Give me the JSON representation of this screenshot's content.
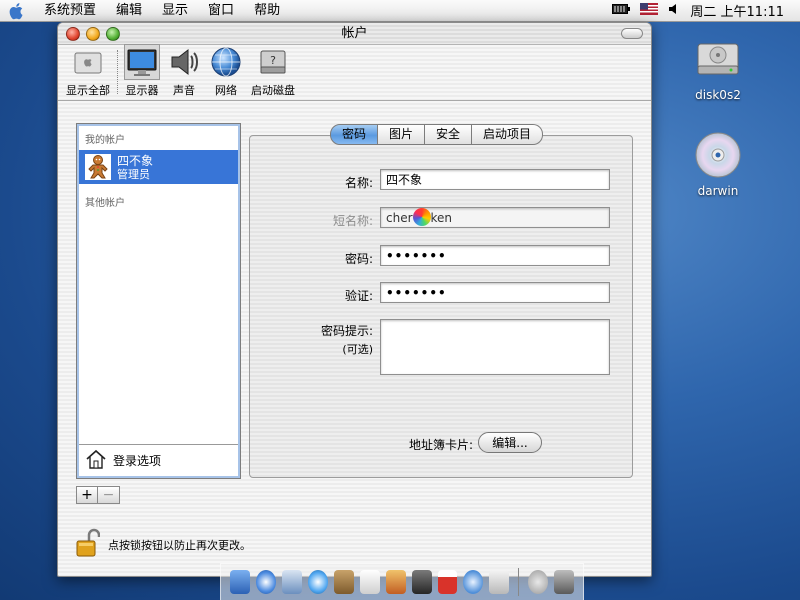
{
  "menubar": {
    "items": [
      {
        "label": "系统预置"
      },
      {
        "label": "编辑"
      },
      {
        "label": "显示"
      },
      {
        "label": "窗口"
      },
      {
        "label": "帮助"
      }
    ],
    "clock": "周二 上午11:11"
  },
  "desktop": {
    "icons": [
      {
        "label": "disk0s2",
        "icon": "hard-disk-icon"
      },
      {
        "label": "darwin",
        "icon": "cd-disc-icon"
      }
    ]
  },
  "window": {
    "title": "帐户",
    "toolbar": [
      {
        "label": "显示全部",
        "icon": "show-all-icon"
      },
      {
        "label": "显示器",
        "icon": "display-icon",
        "selected": true
      },
      {
        "label": "声音",
        "icon": "speaker-icon"
      },
      {
        "label": "网络",
        "icon": "network-globe-icon"
      },
      {
        "label": "启动磁盘",
        "icon": "startup-disk-icon"
      }
    ]
  },
  "accounts": {
    "my_header": "我的帐户",
    "current_user": {
      "name": "四不象",
      "role": "管理员"
    },
    "other_header": "其他帐户",
    "login_options": "登录选项",
    "add_label": "+",
    "remove_label": "−"
  },
  "tabs": [
    {
      "label": "密码",
      "active": true
    },
    {
      "label": "图片"
    },
    {
      "label": "安全"
    },
    {
      "label": "启动项目"
    }
  ],
  "form": {
    "name_label": "名称:",
    "name_value": "四不象",
    "short_label": "短名称:",
    "short_value_start": "cher",
    "short_value_end": "ken",
    "password_label": "密码:",
    "password_value": "•••••••",
    "verify_label": "验证:",
    "verify_value": "•••••••",
    "hint_label": "密码提示:",
    "hint_optional": "(可选)",
    "hint_value": "",
    "addressbook_label": "地址簿卡片:",
    "edit_label": "编辑..."
  },
  "lock_text": "点按锁按钮以防止再次更改。",
  "colors": {
    "selection": "#3875d7",
    "active_tab": "#5b9ae0",
    "desktop": "#2f66ad"
  }
}
